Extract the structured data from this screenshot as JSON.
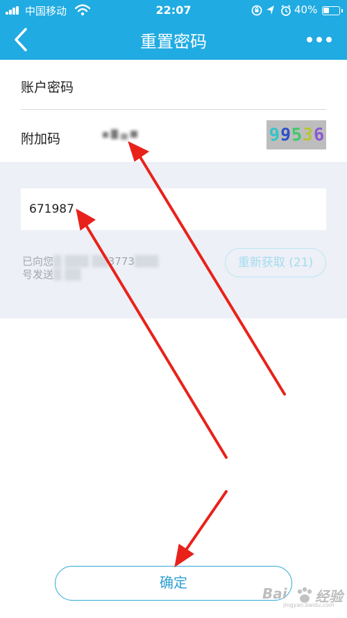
{
  "status_bar": {
    "carrier": "中国移动",
    "time": "22:07",
    "battery_percent": "40%",
    "battery_level": 0.4
  },
  "nav": {
    "title": "重置密码",
    "back_icon": "chevron-left-icon",
    "more_icon": "more-dots-icon"
  },
  "form": {
    "account_password_label": "账户密码",
    "extra_code_label": "附加码",
    "captcha_text": "99536",
    "sms_code_value": "671987",
    "sent_line1_prefix": "已向您",
    "sent_line1_visible": "3773",
    "sent_line2_prefix": "号发送",
    "resend_label": "重新获取 (21)"
  },
  "confirm_label": "确定",
  "watermark": {
    "left": "Bai",
    "right": "经验",
    "sub": "jingyan.baidu.com"
  },
  "colors": {
    "header": "#20abe2",
    "grey_section": "#edf0f6",
    "confirm_text": "#2c9fd2",
    "arrow": "#e8221b"
  }
}
